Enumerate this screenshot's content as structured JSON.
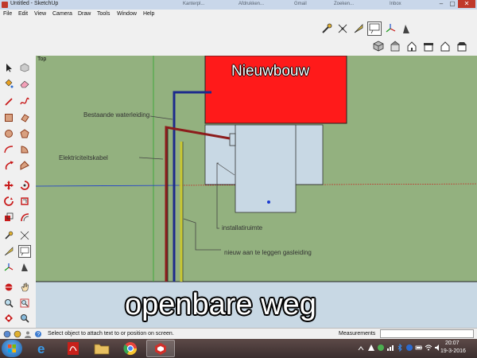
{
  "window": {
    "title": "Untitled - SketchUp",
    "background_tabs": [
      "Kanterpl...",
      "Afdrukken...",
      "Gmail",
      "Zoeken...",
      "Inbox"
    ]
  },
  "menu": [
    "File",
    "Edit",
    "View",
    "Camera",
    "Draw",
    "Tools",
    "Window",
    "Help"
  ],
  "viewport": {
    "view_name": "Top",
    "building_label": "Nieuwbouw",
    "road_label": "openbare weg",
    "annotations": {
      "water": "Bestaande waterleiding",
      "electric": "Elektriciteitskabel",
      "install": "installatiruimte",
      "gas": "nieuw aan te leggen gasleiding"
    }
  },
  "status": {
    "message": "Select object to attach text to or position on screen.",
    "measurements_label": "Measurements",
    "measurements_value": ""
  },
  "taskbar": {
    "time": "20:07",
    "date": "19-3-2016"
  },
  "colors": {
    "ground": "#93b17f",
    "building": "#ff1a1a",
    "road": "#c8d8e4",
    "water": "#1c2a8c",
    "electric": "#8c1c1c",
    "gas": "#c8c832"
  },
  "icons": {
    "toolbar_row1": [
      "tape-measure-icon",
      "dimension-icon",
      "protractor-icon",
      "text-icon",
      "axes-icon",
      "3d-text-icon"
    ],
    "toolbar_row2": [
      "iso-view-icon",
      "top-view-icon",
      "front-view-icon",
      "right-view-icon",
      "back-view-icon",
      "left-view-icon"
    ],
    "left_palette": [
      "select-icon",
      "make-component-icon",
      "paint-bucket-icon",
      "eraser-icon",
      "line-icon",
      "freehand-icon",
      "rectangle-icon",
      "rotated-rectangle-icon",
      "circle-icon",
      "polygon-icon",
      "arc-icon",
      "pie-icon",
      "pushpull-icon",
      "follow-me-icon",
      "move-icon",
      "rotate-icon",
      "scale-icon",
      "offset-icon",
      "tape-measure-icon",
      "dimension-icon",
      "protractor-icon",
      "text-icon",
      "axes-icon",
      "3d-text-icon",
      "orbit-icon",
      "pan-icon",
      "zoom-icon",
      "zoom-window-icon",
      "zoom-extents-icon",
      "previous-view-icon"
    ]
  }
}
